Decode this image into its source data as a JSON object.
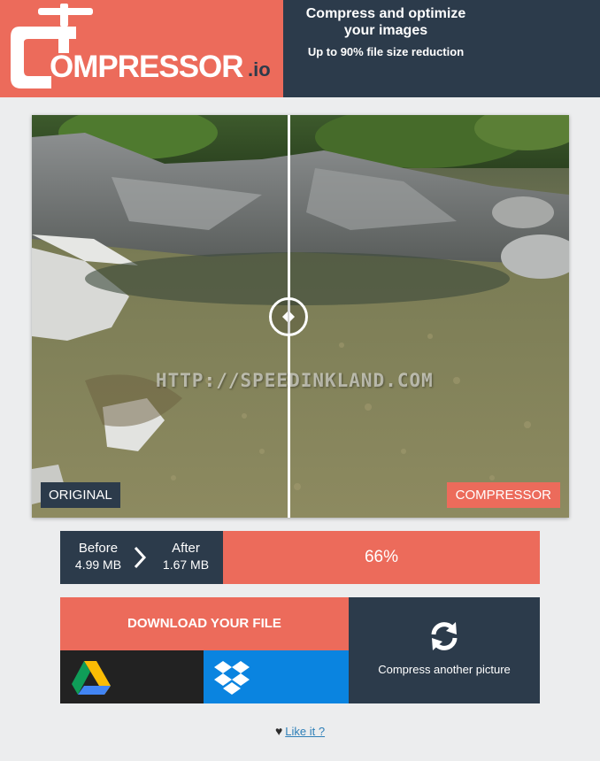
{
  "header": {
    "logo_main": "OMPRESSOR",
    "logo_tld": ".io",
    "tagline": "Compress and optimize your images",
    "subline_prefix": "Up to ",
    "subline_strong": "90%",
    "subline_suffix": " file size reduction",
    "brand_color": "#ec6b5b",
    "dark_color": "#2c3b4b"
  },
  "compare": {
    "original_label": "ORIGINAL",
    "compressed_label": "COMPRESSOR",
    "watermark": "HTTP://SPEEDINKLAND.COM",
    "handle_icon": "left-right-arrows-icon"
  },
  "stats": {
    "before_label": "Before",
    "before_value": "4.99 MB",
    "after_label": "After",
    "after_value": "1.67 MB",
    "reduction": "66%"
  },
  "actions": {
    "download_label": "DOWNLOAD YOUR FILE",
    "another_label": "Compress another picture",
    "gdrive_icon": "google-drive-icon",
    "dropbox_icon": "dropbox-icon",
    "refresh_icon": "refresh-icon"
  },
  "footer": {
    "like_label": "Like it ?",
    "heart_icon": "heart-icon"
  }
}
